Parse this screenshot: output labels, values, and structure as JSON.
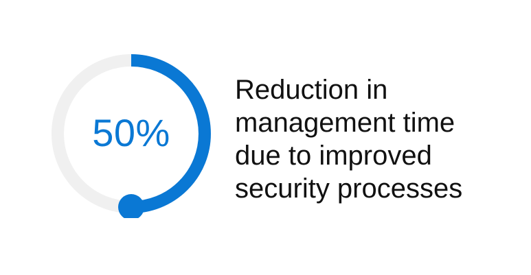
{
  "chart_data": {
    "type": "pie",
    "variant": "progress-ring",
    "value_percent": 50,
    "display_value": "50%",
    "caption_lines": [
      "Reduction in",
      "management time",
      "due to improved",
      "security processes"
    ],
    "colors": {
      "progress": "#0A78D4",
      "track": "#F0F0F0",
      "value_text": "#0A78D4",
      "caption_text": "#111111"
    }
  }
}
